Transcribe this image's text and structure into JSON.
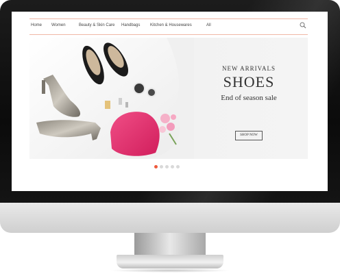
{
  "nav": {
    "items": [
      {
        "label": "Home"
      },
      {
        "label": "Women"
      },
      {
        "label": "Beauty & Skin Care"
      },
      {
        "label": "Handbags"
      },
      {
        "label": "Kitchen & Housewares"
      },
      {
        "label": "All"
      }
    ],
    "search_icon": "search-icon"
  },
  "banner": {
    "subtitle": "NEW ARRIVALS",
    "title": "SHOES",
    "tagline": "End of season sale",
    "button_label": "SHOP NOW"
  },
  "carousel": {
    "slide_count": 5,
    "active_index": 0
  },
  "colors": {
    "accent": "#ee5a3c",
    "nav_border": "#f0b7a6",
    "bag_pink": "#e6306e"
  }
}
